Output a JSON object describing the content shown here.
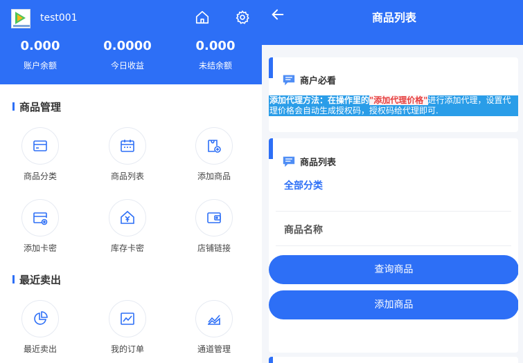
{
  "left": {
    "username": "test001",
    "stats": [
      {
        "value": "0.000",
        "label": "账户余额"
      },
      {
        "value": "0.0000",
        "label": "今日收益"
      },
      {
        "value": "0.000",
        "label": "未结余额"
      }
    ],
    "sections": {
      "goods_title": "商品管理",
      "recent_title": "最近卖出"
    },
    "goods_items": [
      {
        "label": "商品分类",
        "icon": "card-icon"
      },
      {
        "label": "商品列表",
        "icon": "calendar-icon"
      },
      {
        "label": "添加商品",
        "icon": "bag-add-icon"
      },
      {
        "label": "添加卡密",
        "icon": "card-add-icon"
      },
      {
        "label": "库存卡密",
        "icon": "house-yen-icon"
      },
      {
        "label": "店铺链接",
        "icon": "wallet-icon"
      }
    ],
    "recent_items": [
      {
        "label": "最近卖出",
        "icon": "pie-chart-icon"
      },
      {
        "label": "我的订单",
        "icon": "line-chart-icon"
      },
      {
        "label": "通道管理",
        "icon": "area-chart-icon"
      }
    ]
  },
  "right": {
    "title": "商品列表",
    "notice": {
      "heading": "商户必看",
      "text_prefix": "添加代理方法：在操作里的",
      "text_highlight": "\"添加代理价格\"",
      "text_suffix": "进行添加代理，设置代理价格会自动生成授权码，授权码给代理即可."
    },
    "list": {
      "heading": "商品列表",
      "category": "全部分类",
      "name_label": "商品名称",
      "query_button": "查询商品",
      "add_button": "添加商品"
    }
  },
  "colors": {
    "primary": "#2d6ff6",
    "notice_bg": "#2a9de8",
    "highlight": "#e53f3f"
  }
}
